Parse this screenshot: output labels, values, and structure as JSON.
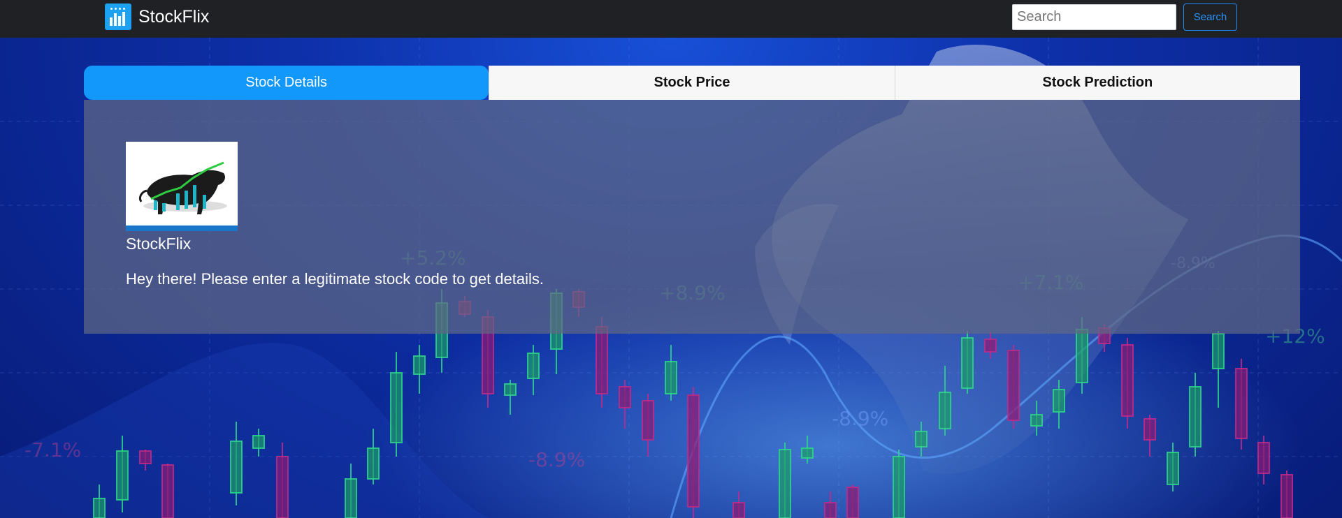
{
  "navbar": {
    "brand_name": "StockFlix",
    "brand_icon": "bar-chart-icon",
    "search_placeholder": "Search",
    "search_button_label": "Search"
  },
  "tabs": [
    {
      "label": "Stock Details",
      "active": true
    },
    {
      "label": "Stock Price",
      "active": false
    },
    {
      "label": "Stock Prediction",
      "active": false
    }
  ],
  "details": {
    "image_alt": "bull-chart-image",
    "name": "StockFlix",
    "message": "Hey there! Please enter a legitimate stock code to get details."
  },
  "background": {
    "labels": [
      "+5.2%",
      "+8.9%",
      "+7.1%",
      "-8.9%",
      "+12%",
      "-7.1%",
      "-8.9%",
      "-8.9%"
    ]
  },
  "colors": {
    "navbar": "#1f2124",
    "accent": "#1298fb",
    "candle_up": "#2fd58a",
    "candle_down": "#c02a8c"
  }
}
